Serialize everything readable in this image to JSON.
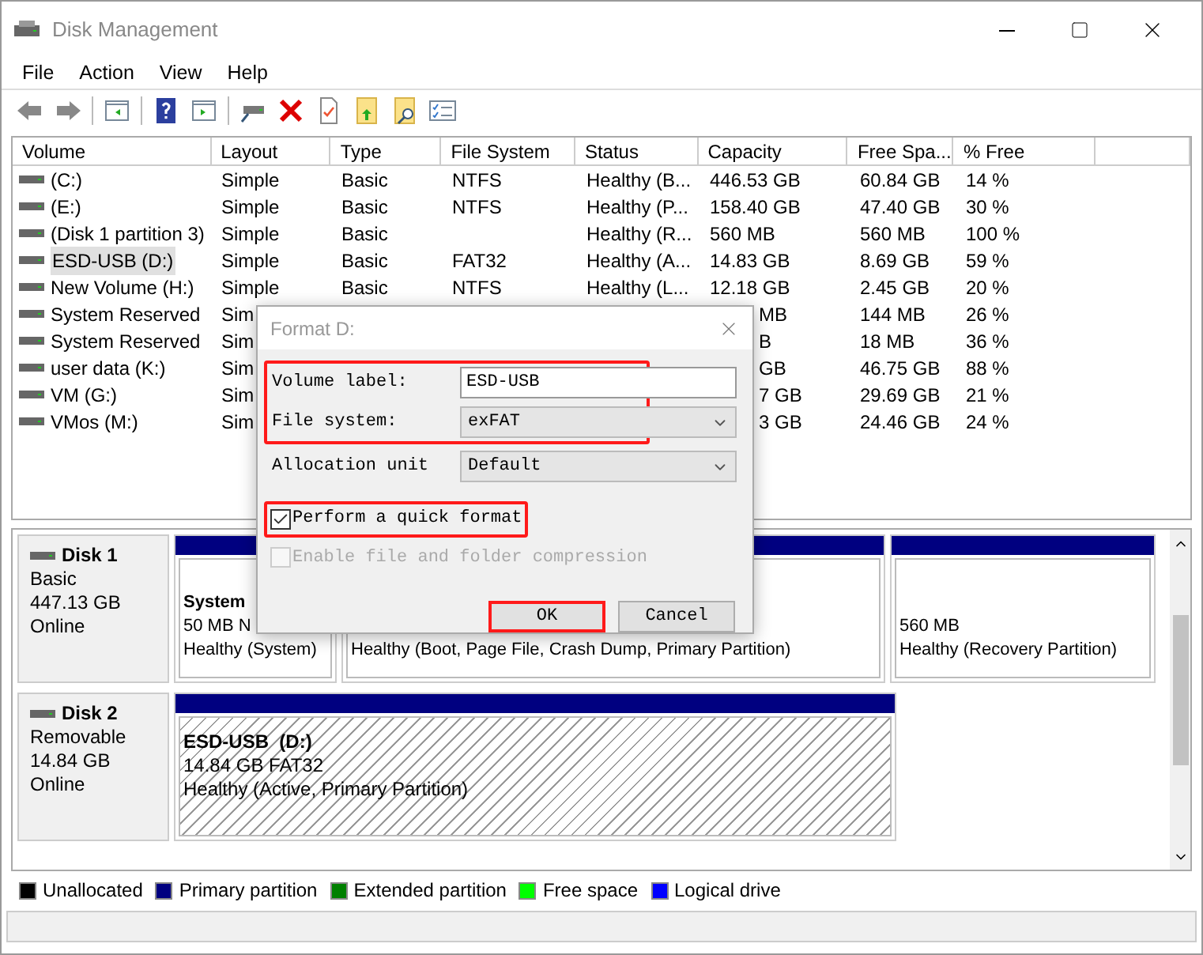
{
  "window": {
    "title": "Disk Management"
  },
  "menu": [
    "File",
    "Action",
    "View",
    "Help"
  ],
  "table": {
    "columns": [
      "Volume",
      "Layout",
      "Type",
      "File System",
      "Status",
      "Capacity",
      "Free Spa...",
      "% Free"
    ],
    "rows": [
      {
        "selected": false,
        "cells": [
          "(C:)",
          "Simple",
          "Basic",
          "NTFS",
          "Healthy (B...",
          "446.53 GB",
          "60.84 GB",
          "14 %"
        ]
      },
      {
        "selected": false,
        "cells": [
          "(E:)",
          "Simple",
          "Basic",
          "NTFS",
          "Healthy (P...",
          "158.40 GB",
          "47.40 GB",
          "30 %"
        ]
      },
      {
        "selected": false,
        "cells": [
          "(Disk 1 partition 3)",
          "Simple",
          "Basic",
          null,
          "Healthy (R...",
          "560 MB",
          "560 MB",
          "100 %"
        ]
      },
      {
        "selected": true,
        "cells": [
          "ESD-USB (D:)",
          "Simple",
          "Basic",
          "FAT32",
          "Healthy (A...",
          "14.83 GB",
          "8.69 GB",
          "59 %"
        ]
      },
      {
        "selected": false,
        "cells": [
          "New Volume (H:)",
          "Simple",
          "Basic",
          "NTFS",
          "Healthy (L...",
          "12.18 GB",
          "2.45 GB",
          "20 %"
        ]
      },
      {
        "selected": false,
        "cells": [
          "System Reserved",
          "Sim",
          null,
          null,
          null,
          "MB",
          "144 MB",
          "26 %"
        ]
      },
      {
        "selected": false,
        "cells": [
          "System Reserved",
          "Sim",
          null,
          null,
          null,
          "B",
          "18 MB",
          "36 %"
        ]
      },
      {
        "selected": false,
        "cells": [
          "user data (K:)",
          "Sim",
          null,
          null,
          null,
          "GB",
          "46.75 GB",
          "88 %"
        ]
      },
      {
        "selected": false,
        "cells": [
          "VM (G:)",
          "Sim",
          null,
          null,
          null,
          "7 GB",
          "29.69 GB",
          "21 %"
        ]
      },
      {
        "selected": false,
        "cells": [
          "VMos (M:)",
          "Sim",
          null,
          null,
          null,
          "3 GB",
          "24.46 GB",
          "24 %"
        ]
      }
    ]
  },
  "disks": [
    {
      "name": "Disk 1",
      "type": "Basic",
      "size": "447.13 GB",
      "status": "Online",
      "partitions": [
        {
          "hatched": false,
          "title": "System",
          "lines": [
            "50 MB N",
            "Healthy (System)"
          ]
        },
        {
          "hatched": false,
          "lines": [
            "Healthy (Boot, Page File, Crash Dump, Primary Partition)"
          ]
        },
        {
          "hatched": false,
          "lines": [
            "560 MB",
            "Healthy (Recovery Partition)"
          ]
        }
      ]
    },
    {
      "name": "Disk 2",
      "type": "Removable",
      "size": "14.84 GB",
      "status": "Online",
      "partitions": [
        {
          "hatched": true,
          "title": "ESD-USB  (D:)",
          "lines": [
            "14.84 GB FAT32",
            "Healthy (Active, Primary Partition)"
          ]
        }
      ]
    }
  ],
  "legend": [
    {
      "label": "Unallocated",
      "color": "#000000"
    },
    {
      "label": "Primary partition",
      "color": "#000080"
    },
    {
      "label": "Extended partition",
      "color": "#008000"
    },
    {
      "label": "Free space",
      "color": "#00ff00"
    },
    {
      "label": "Logical drive",
      "color": "#0000ff"
    }
  ],
  "dialog": {
    "title": "Format D:",
    "field_groups": [
      {
        "highlighted": true,
        "fields": [
          {
            "label": "Volume label:",
            "value": "ESD-USB",
            "kind": "text"
          },
          {
            "label": "File system:",
            "value": "exFAT",
            "kind": "select"
          }
        ]
      },
      {
        "highlighted": false,
        "fields": [
          {
            "label": "Allocation unit",
            "value": "Default",
            "kind": "select"
          }
        ]
      }
    ],
    "options": [
      {
        "label": "Perform a quick format",
        "checked": true,
        "disabled": false,
        "highlighted": true
      },
      {
        "label": "Enable file and folder compression",
        "checked": false,
        "disabled": true,
        "highlighted": false
      }
    ],
    "buttons": [
      {
        "label": "OK",
        "highlighted": true
      },
      {
        "label": "Cancel",
        "highlighted": false
      }
    ]
  }
}
